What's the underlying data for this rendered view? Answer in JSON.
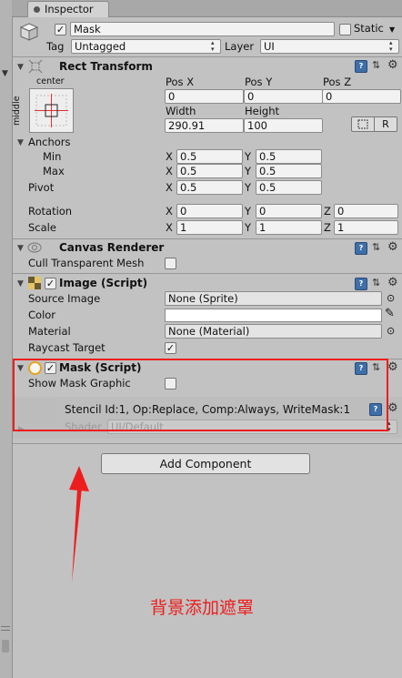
{
  "tab": {
    "label": "Inspector"
  },
  "object": {
    "name": "Mask",
    "static_label": "Static",
    "tag_label": "Tag",
    "tag_value": "Untagged",
    "layer_label": "Layer",
    "layer_value": "UI"
  },
  "rect_transform": {
    "title": "Rect Transform",
    "anchor_preset_top": "center",
    "anchor_preset_side": "middle",
    "pos_x_label": "Pos X",
    "pos_y_label": "Pos Y",
    "pos_z_label": "Pos Z",
    "pos_x": "0",
    "pos_y": "0",
    "pos_z": "0",
    "width_label": "Width",
    "height_label": "Height",
    "width": "290.91",
    "height": "100",
    "raw_button": "R",
    "anchors_label": "Anchors",
    "min_label": "Min",
    "max_label": "Max",
    "min_x": "0.5",
    "min_y": "0.5",
    "max_x": "0.5",
    "max_y": "0.5",
    "pivot_label": "Pivot",
    "pivot_x": "0.5",
    "pivot_y": "0.5",
    "rotation_label": "Rotation",
    "rot_x": "0",
    "rot_y": "0",
    "rot_z": "0",
    "scale_label": "Scale",
    "scale_x": "1",
    "scale_y": "1",
    "scale_z": "1",
    "x": "X",
    "y": "Y",
    "z": "Z"
  },
  "canvas_renderer": {
    "title": "Canvas Renderer",
    "cull_label": "Cull Transparent Mesh"
  },
  "image": {
    "title": "Image (Script)",
    "source_label": "Source Image",
    "source_value": "None (Sprite)",
    "color_label": "Color",
    "material_label": "Material",
    "material_value": "None (Material)",
    "raycast_label": "Raycast Target"
  },
  "mask": {
    "title": "Mask (Script)",
    "show_label": "Show Mask Graphic"
  },
  "material_preview": {
    "stencil": "Stencil Id:1, Op:Replace, Comp:Always, WriteMask:1",
    "shader_label": "Shader",
    "shader_value": "UI/Default"
  },
  "add_component": "Add Component",
  "annotation": "背景添加遮罩"
}
